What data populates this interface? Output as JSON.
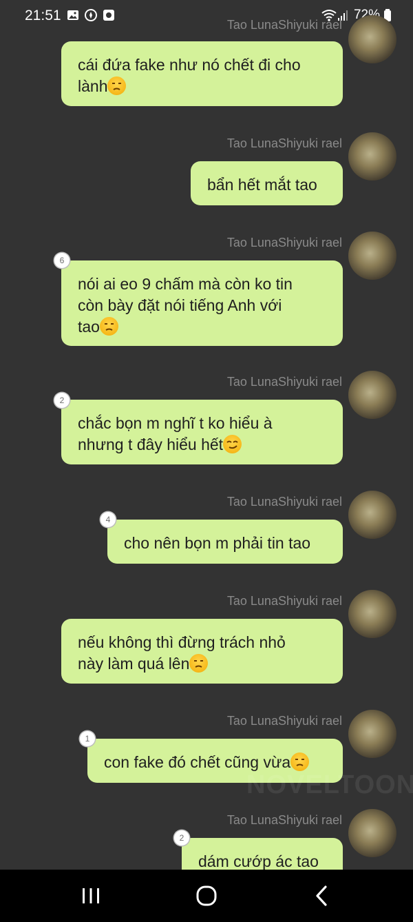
{
  "status_bar": {
    "time": "21:51",
    "battery": "72%",
    "icons": [
      "gallery-icon",
      "compass-icon",
      "app-icon",
      "wifi-icon",
      "signal-icon",
      "battery-icon"
    ]
  },
  "messages": [
    {
      "sender": "Tao LunaShiyuki rael",
      "text": "cái đứa fake như nó chết đi cho\nlành",
      "emoji": "unamused-emoji",
      "badge": null
    },
    {
      "sender": "Tao LunaShiyuki rael",
      "text": "bẩn hết mắt tao",
      "emoji": null,
      "badge": null
    },
    {
      "sender": "Tao LunaShiyuki rael",
      "text": "nói ai eo 9 chấm mà còn ko tin\ncòn bày đặt nói tiếng Anh với\ntao",
      "emoji": "unamused-emoji",
      "badge": "6"
    },
    {
      "sender": "Tao LunaShiyuki rael",
      "text": "chắc bọn m nghĩ t ko hiểu à\nnhưng t đây hiểu hết",
      "emoji": "smirk-emoji",
      "badge": "2"
    },
    {
      "sender": "Tao LunaShiyuki rael",
      "text": "cho nên bọn m phải tin tao",
      "emoji": null,
      "badge": "4"
    },
    {
      "sender": "Tao LunaShiyuki rael",
      "text": "nếu không thì đừng trách nhỏ\nnày làm quá lên",
      "emoji": "unamused-emoji",
      "badge": null
    },
    {
      "sender": "Tao LunaShiyuki rael",
      "text": "con fake đó chết cũng vừa",
      "emoji": "unamused-emoji",
      "badge": "1"
    },
    {
      "sender": "Tao LunaShiyuki rael",
      "text": "dám cướp ác tao",
      "emoji": null,
      "badge": "2"
    }
  ],
  "watermark": "NOVELTOON",
  "nav": {
    "items": [
      "recents-icon",
      "home-icon",
      "back-icon"
    ]
  }
}
